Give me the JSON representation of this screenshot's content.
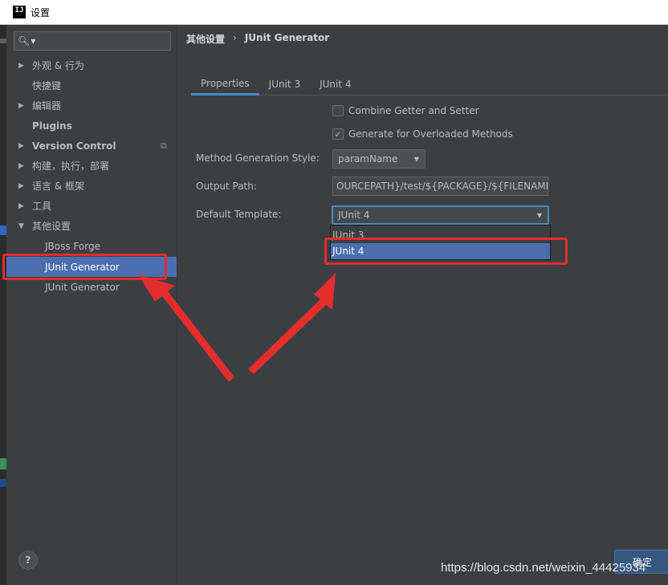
{
  "window": {
    "title": "设置",
    "logo_text": "IJ"
  },
  "sidebar": {
    "search": {
      "value": "",
      "placeholder": ""
    },
    "items": [
      {
        "label": "外观 & 行为",
        "has_arrow": true,
        "arrow": "▶"
      },
      {
        "label": "快捷键",
        "has_arrow": false
      },
      {
        "label": "编辑器",
        "has_arrow": true,
        "arrow": "▶"
      },
      {
        "label": "Plugins",
        "has_arrow": false
      },
      {
        "label": "Version Control",
        "has_arrow": true,
        "arrow": "▶",
        "copy_icon": "copy-icon"
      },
      {
        "label": "构建，执行，部署",
        "has_arrow": true,
        "arrow": "▶"
      },
      {
        "label": "语言 & 框架",
        "has_arrow": true,
        "arrow": "▶"
      },
      {
        "label": "工具",
        "has_arrow": true,
        "arrow": "▶"
      },
      {
        "label": "其他设置",
        "has_arrow": true,
        "arrow": "▼",
        "expanded": true
      },
      {
        "label": "JBoss Forge",
        "child": true
      },
      {
        "label": "JUnit Generator",
        "child": true,
        "selected": true
      },
      {
        "label": "JUnit Generator",
        "child": true,
        "copy_icon": "copy-icon"
      }
    ],
    "help_label": "?"
  },
  "content": {
    "breadcrumb": {
      "parent": "其他设置",
      "separator": "›",
      "current": "JUnit Generator"
    },
    "tabs": [
      {
        "label": "Properties",
        "active": true
      },
      {
        "label": "JUnit 3",
        "active": false
      },
      {
        "label": "JUnit 4",
        "active": false
      }
    ],
    "checkboxes": [
      {
        "label": "Combine Getter and Setter",
        "checked": false
      },
      {
        "label": "Generate for Overloaded Methods",
        "checked": true
      }
    ],
    "method_generation_style": {
      "label": "Method Generation Style:",
      "value": "paramName"
    },
    "output_path": {
      "label": "Output Path:",
      "value": "OURCEPATH}/test/${PACKAGE}/${FILENAME}"
    },
    "default_template": {
      "label": "Default Template:",
      "value": "JUnit 4",
      "options": [
        "JUnit 3",
        "JUnit 4"
      ],
      "selected_option": "JUnit 4"
    },
    "ok_button": "确定"
  },
  "watermark": "https://blog.csdn.net/weixin_44425934",
  "colors": {
    "background": "#3c3f41",
    "selection": "#4b6eaf",
    "accent": "#4a88c7",
    "annotation": "#e52d2d",
    "ok_button": "#365880"
  }
}
